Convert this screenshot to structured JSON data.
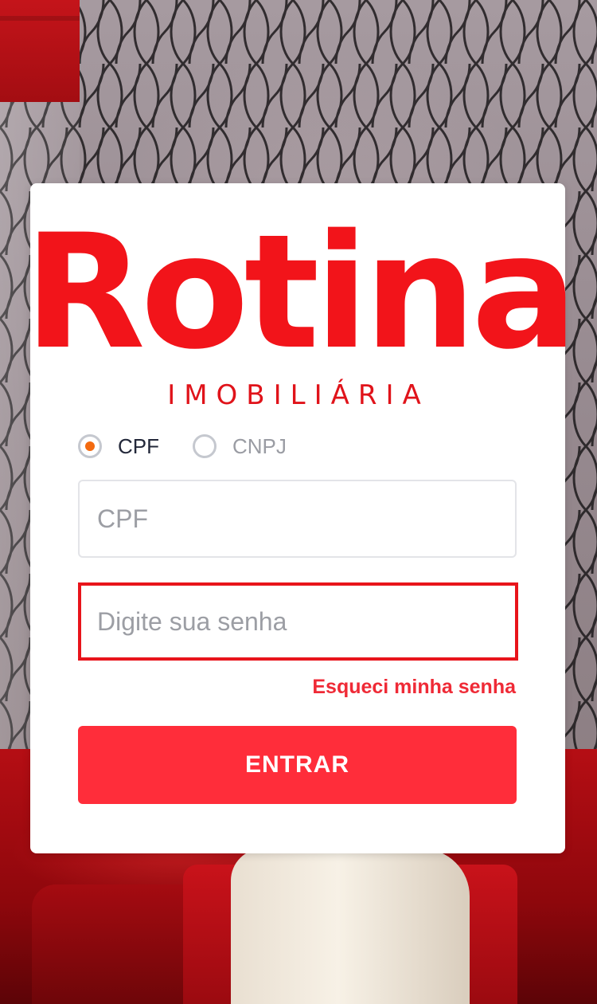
{
  "brand": {
    "name": "Rotina",
    "tagline": "IMOBILIÁRIA",
    "color": "#f2141a"
  },
  "login": {
    "doc_type": {
      "options": [
        {
          "label": "CPF",
          "selected": true
        },
        {
          "label": "CNPJ",
          "selected": false
        }
      ]
    },
    "cpf_input": {
      "placeholder": "CPF",
      "value": ""
    },
    "password_input": {
      "placeholder": "Digite sua senha",
      "value": "",
      "state": "error"
    },
    "forgot_link": "Esqueci minha senha",
    "submit_label": "ENTRAR"
  },
  "colors": {
    "accent": "#ff2d3a",
    "radio_selected": "#f36a10",
    "error_border": "#e8141b",
    "link": "#ef2a36"
  }
}
